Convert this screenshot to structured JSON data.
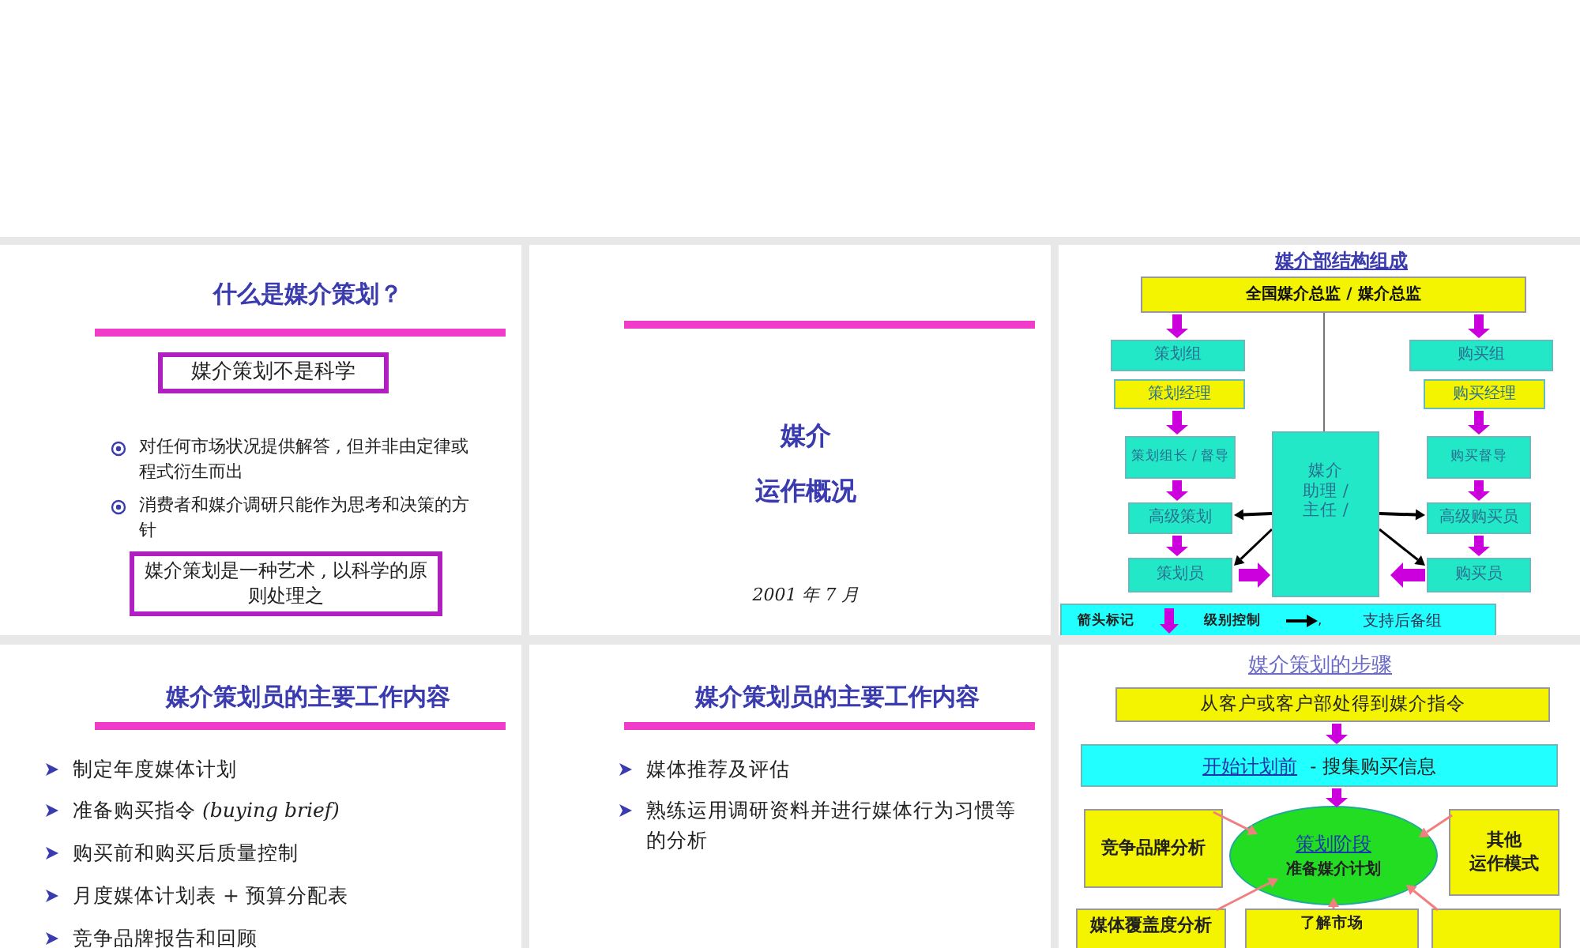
{
  "slides": [
    {
      "kind": "intro",
      "title": "什么是媒介策划？",
      "statement": "媒介策划不是科学",
      "bullets": [
        "对任何市场状况提供解答 , 但并非由定律或程式衍生而出",
        "消费者和媒介调研只能作为思考和决策的方针"
      ],
      "conclusion": "媒介策划是一种艺术 , 以科学的原则处理之"
    },
    {
      "kind": "cover",
      "lines": [
        "媒介",
        "运作概况"
      ],
      "date": "2001 年 7 月"
    },
    {
      "kind": "org",
      "title": "媒介部结构组成",
      "head": "全国媒介总监 / 媒介总监",
      "left": [
        {
          "label": "策划组",
          "color": "#22e8c8"
        },
        {
          "label": "策划经理",
          "color": "#f4f400"
        },
        {
          "label": "策划组长 / 督导",
          "color": "#22e8c8"
        },
        {
          "label": "高级策划",
          "color": "#22e8c8"
        },
        {
          "label": "策划员",
          "color": "#22e8c8"
        }
      ],
      "right": [
        {
          "label": "购买组",
          "color": "#22e8c8"
        },
        {
          "label": "购买经理",
          "color": "#f4f400"
        },
        {
          "label": "购买督导",
          "color": "#22e8c8"
        },
        {
          "label": "高级购买员",
          "color": "#22e8c8"
        },
        {
          "label": "购买员",
          "color": "#22e8c8"
        }
      ],
      "center": [
        "媒介",
        "助理 /",
        "主任 /"
      ],
      "legend": [
        "箭头标记",
        "级别控制",
        ",",
        "支持后备组"
      ]
    },
    {
      "kind": "list",
      "title": "媒介策划员的主要工作内容",
      "bullets": [
        "制定年度媒体计划",
        "准备购买指令 *(buying brief)*",
        "购买前和购买后质量控制",
        "月度媒体计划表 + 预算分配表",
        "竞争品牌报告和回顾"
      ]
    },
    {
      "kind": "list",
      "title": "媒介策划员的主要工作内容",
      "bullets": [
        "媒体推荐及评估",
        "熟练运用调研资料并进行媒体行为习惯等的分析"
      ]
    },
    {
      "kind": "steps",
      "title": "媒介策划的步骤",
      "brief": "从客户或客户部处得到媒介指令",
      "pre_stage": {
        "link": "开始计划前",
        "text": "- 搜集购买信息"
      },
      "stage": {
        "title": "策划阶段",
        "subtitle": "准备媒介计划"
      },
      "inputs": [
        {
          "label": "竞争品牌分析",
          "color": "#f4f400"
        },
        {
          "lines": [
            "其他",
            "运作模式"
          ],
          "color": "#f4f400"
        },
        {
          "label": "媒体覆盖度分析",
          "color": "#f4f400"
        },
        {
          "label": "了解市场",
          "color": "#f4f400"
        },
        {
          "color": "#f4f400"
        }
      ]
    }
  ]
}
